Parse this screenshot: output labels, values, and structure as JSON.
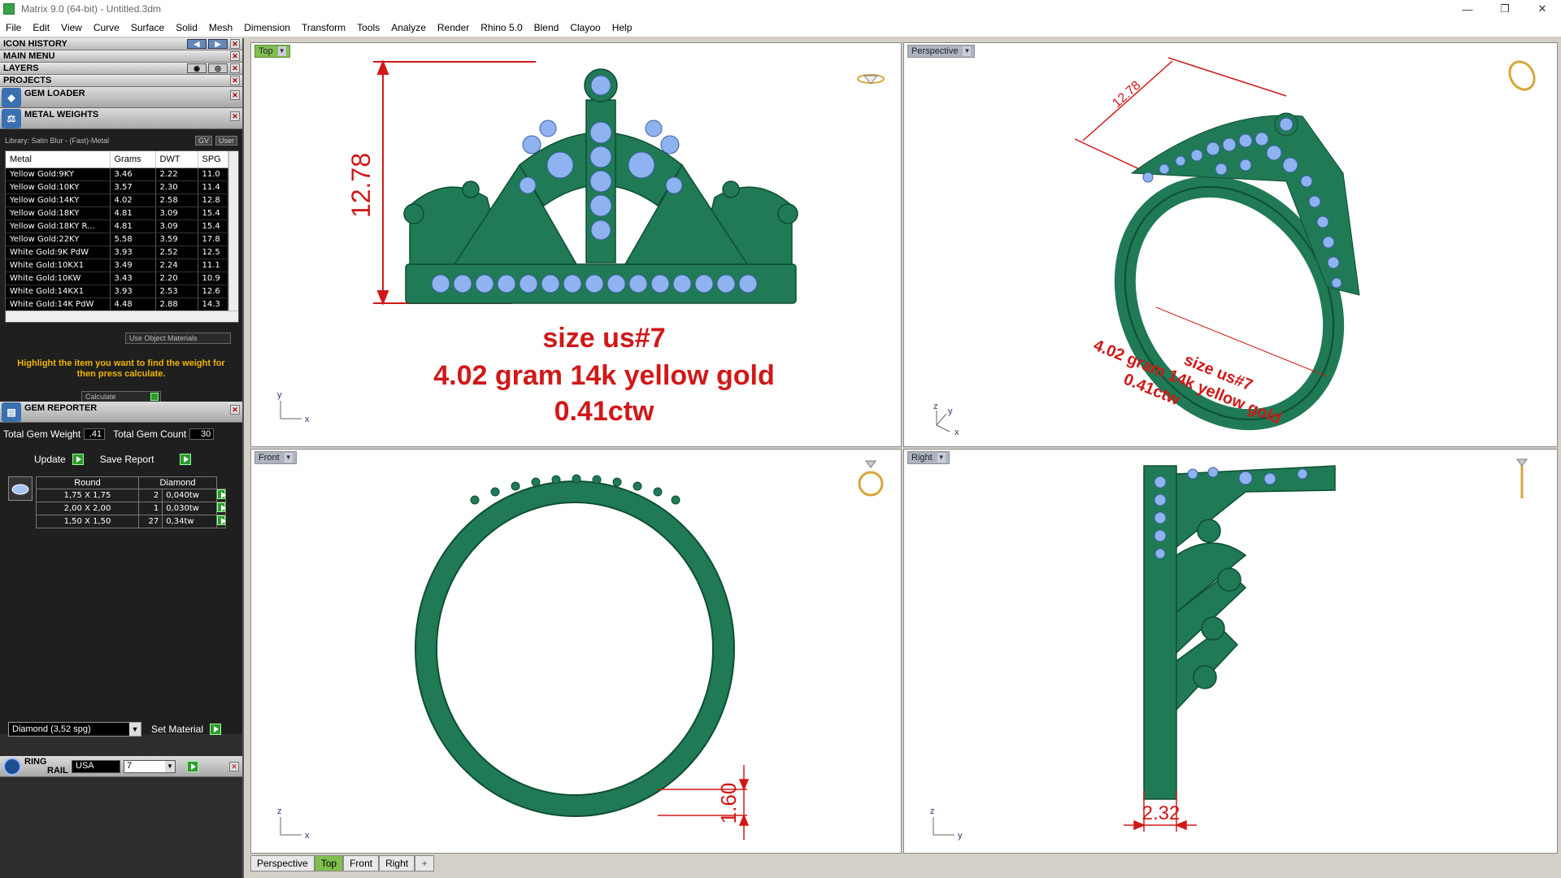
{
  "window": {
    "title": "Matrix 9.0 (64-bit) - Untitled.3dm",
    "controls": [
      "—",
      "❐",
      "✕"
    ]
  },
  "menu": [
    "File",
    "Edit",
    "View",
    "Curve",
    "Surface",
    "Solid",
    "Mesh",
    "Dimension",
    "Transform",
    "Tools",
    "Analyze",
    "Render",
    "Rhino 5.0",
    "Blend",
    "Clayoo",
    "Help"
  ],
  "panels": {
    "icon_history": "ICON HISTORY",
    "main_menu": "MAIN MENU",
    "layers": "LAYERS",
    "projects": "PROJECTS",
    "gem_loader": "GEM LOADER",
    "metal_weights": "METAL WEIGHTS"
  },
  "metal_weights": {
    "library": "Library: Satin Blur - (Fast)-Metal",
    "gv": "GV",
    "user": "User",
    "columns": [
      "Metal",
      "Grams",
      "DWT",
      "SPG"
    ],
    "rows": [
      [
        "Yellow Gold:9KY",
        "3.46",
        "2.22",
        "11.0"
      ],
      [
        "Yellow Gold:10KY",
        "3.57",
        "2.30",
        "11.4"
      ],
      [
        "Yellow Gold:14KY",
        "4.02",
        "2.58",
        "12.8"
      ],
      [
        "Yellow Gold:18KY",
        "4.81",
        "3.09",
        "15.4"
      ],
      [
        "Yellow Gold:18KY R...",
        "4.81",
        "3.09",
        "15.4"
      ],
      [
        "Yellow Gold:22KY",
        "5.58",
        "3.59",
        "17.8"
      ],
      [
        "White Gold:9K PdW",
        "3.93",
        "2.52",
        "12.5"
      ],
      [
        "White Gold:10KX1",
        "3.49",
        "2.24",
        "11.1"
      ],
      [
        "White Gold:10KW",
        "3.43",
        "2.20",
        "10.9"
      ],
      [
        "White Gold:14KX1",
        "3.93",
        "2.53",
        "12.6"
      ],
      [
        "White Gold:14K PdW",
        "4.48",
        "2.88",
        "14.3"
      ]
    ],
    "use_object_materials": "Use Object Materials",
    "hint": "Highlight the item you want to find the weight for then press calculate.",
    "calculate": "Calculate"
  },
  "gem_reporter": {
    "title": "GEM REPORTER",
    "total_weight_label": "Total Gem Weight",
    "total_weight": ".41",
    "total_count_label": "Total Gem Count",
    "total_count": "30",
    "update": "Update",
    "save_report": "Save Report",
    "columns": [
      "Round",
      "Diamond"
    ],
    "rows": [
      [
        "1,75 X 1,75",
        "2",
        "0,040tw"
      ],
      [
        "2,00 X 2,00",
        "1",
        "0,030tw"
      ],
      [
        "1,50 X 1,50",
        "27",
        "0,34tw"
      ]
    ],
    "material": "Diamond   (3,52 spg)",
    "set_material": "Set Material"
  },
  "ring_rail": {
    "title_line1": "RING",
    "title_line2": "RAIL",
    "standard": "USA",
    "size": "7"
  },
  "viewports": {
    "top": {
      "label": "Top",
      "dimension": "12.78",
      "text1": "size us#7",
      "text2": "4.02 gram 14k yellow gold",
      "text3": "0.41ctw"
    },
    "perspective": {
      "label": "Perspective",
      "dimension": "12.78",
      "text1": "size us#7",
      "text2": "4.02 gram 14k yellow gold",
      "text3": "0.41ctw"
    },
    "front": {
      "label": "Front",
      "dimension": "1.60"
    },
    "right": {
      "label": "Right",
      "dimension": "2.32"
    }
  },
  "bottom_tabs": [
    "Perspective",
    "Top",
    "Front",
    "Right"
  ],
  "colors": {
    "metal": "#1f7a55",
    "gem": "#8eb3f0",
    "dimension": "#d01818",
    "active_tab": "#7fbf4f"
  }
}
